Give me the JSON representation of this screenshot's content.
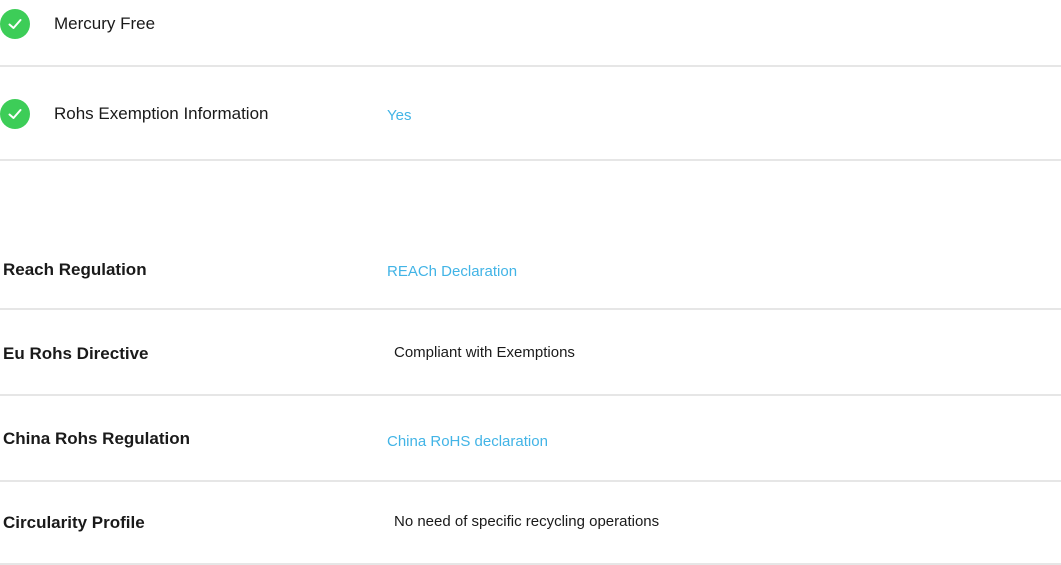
{
  "features": [
    {
      "icon": "check-circle-icon",
      "label": "Mercury Free",
      "value": ""
    },
    {
      "icon": "check-circle-icon",
      "label": "Rohs Exemption Information",
      "value": "Yes"
    }
  ],
  "specs": [
    {
      "label": "Reach Regulation",
      "value": "REACh Declaration",
      "is_link": true
    },
    {
      "label": "Eu Rohs Directive",
      "value": "Compliant with Exemptions",
      "is_link": false
    },
    {
      "label": "China Rohs Regulation",
      "value": "China RoHS declaration",
      "is_link": true
    },
    {
      "label": "Circularity Profile",
      "value": "No need of specific recycling operations",
      "is_link": false
    }
  ],
  "colors": {
    "check": "#3dcd58",
    "link": "#42b4e6",
    "divider": "#e6e6e6",
    "text": "#1a1a1a"
  }
}
